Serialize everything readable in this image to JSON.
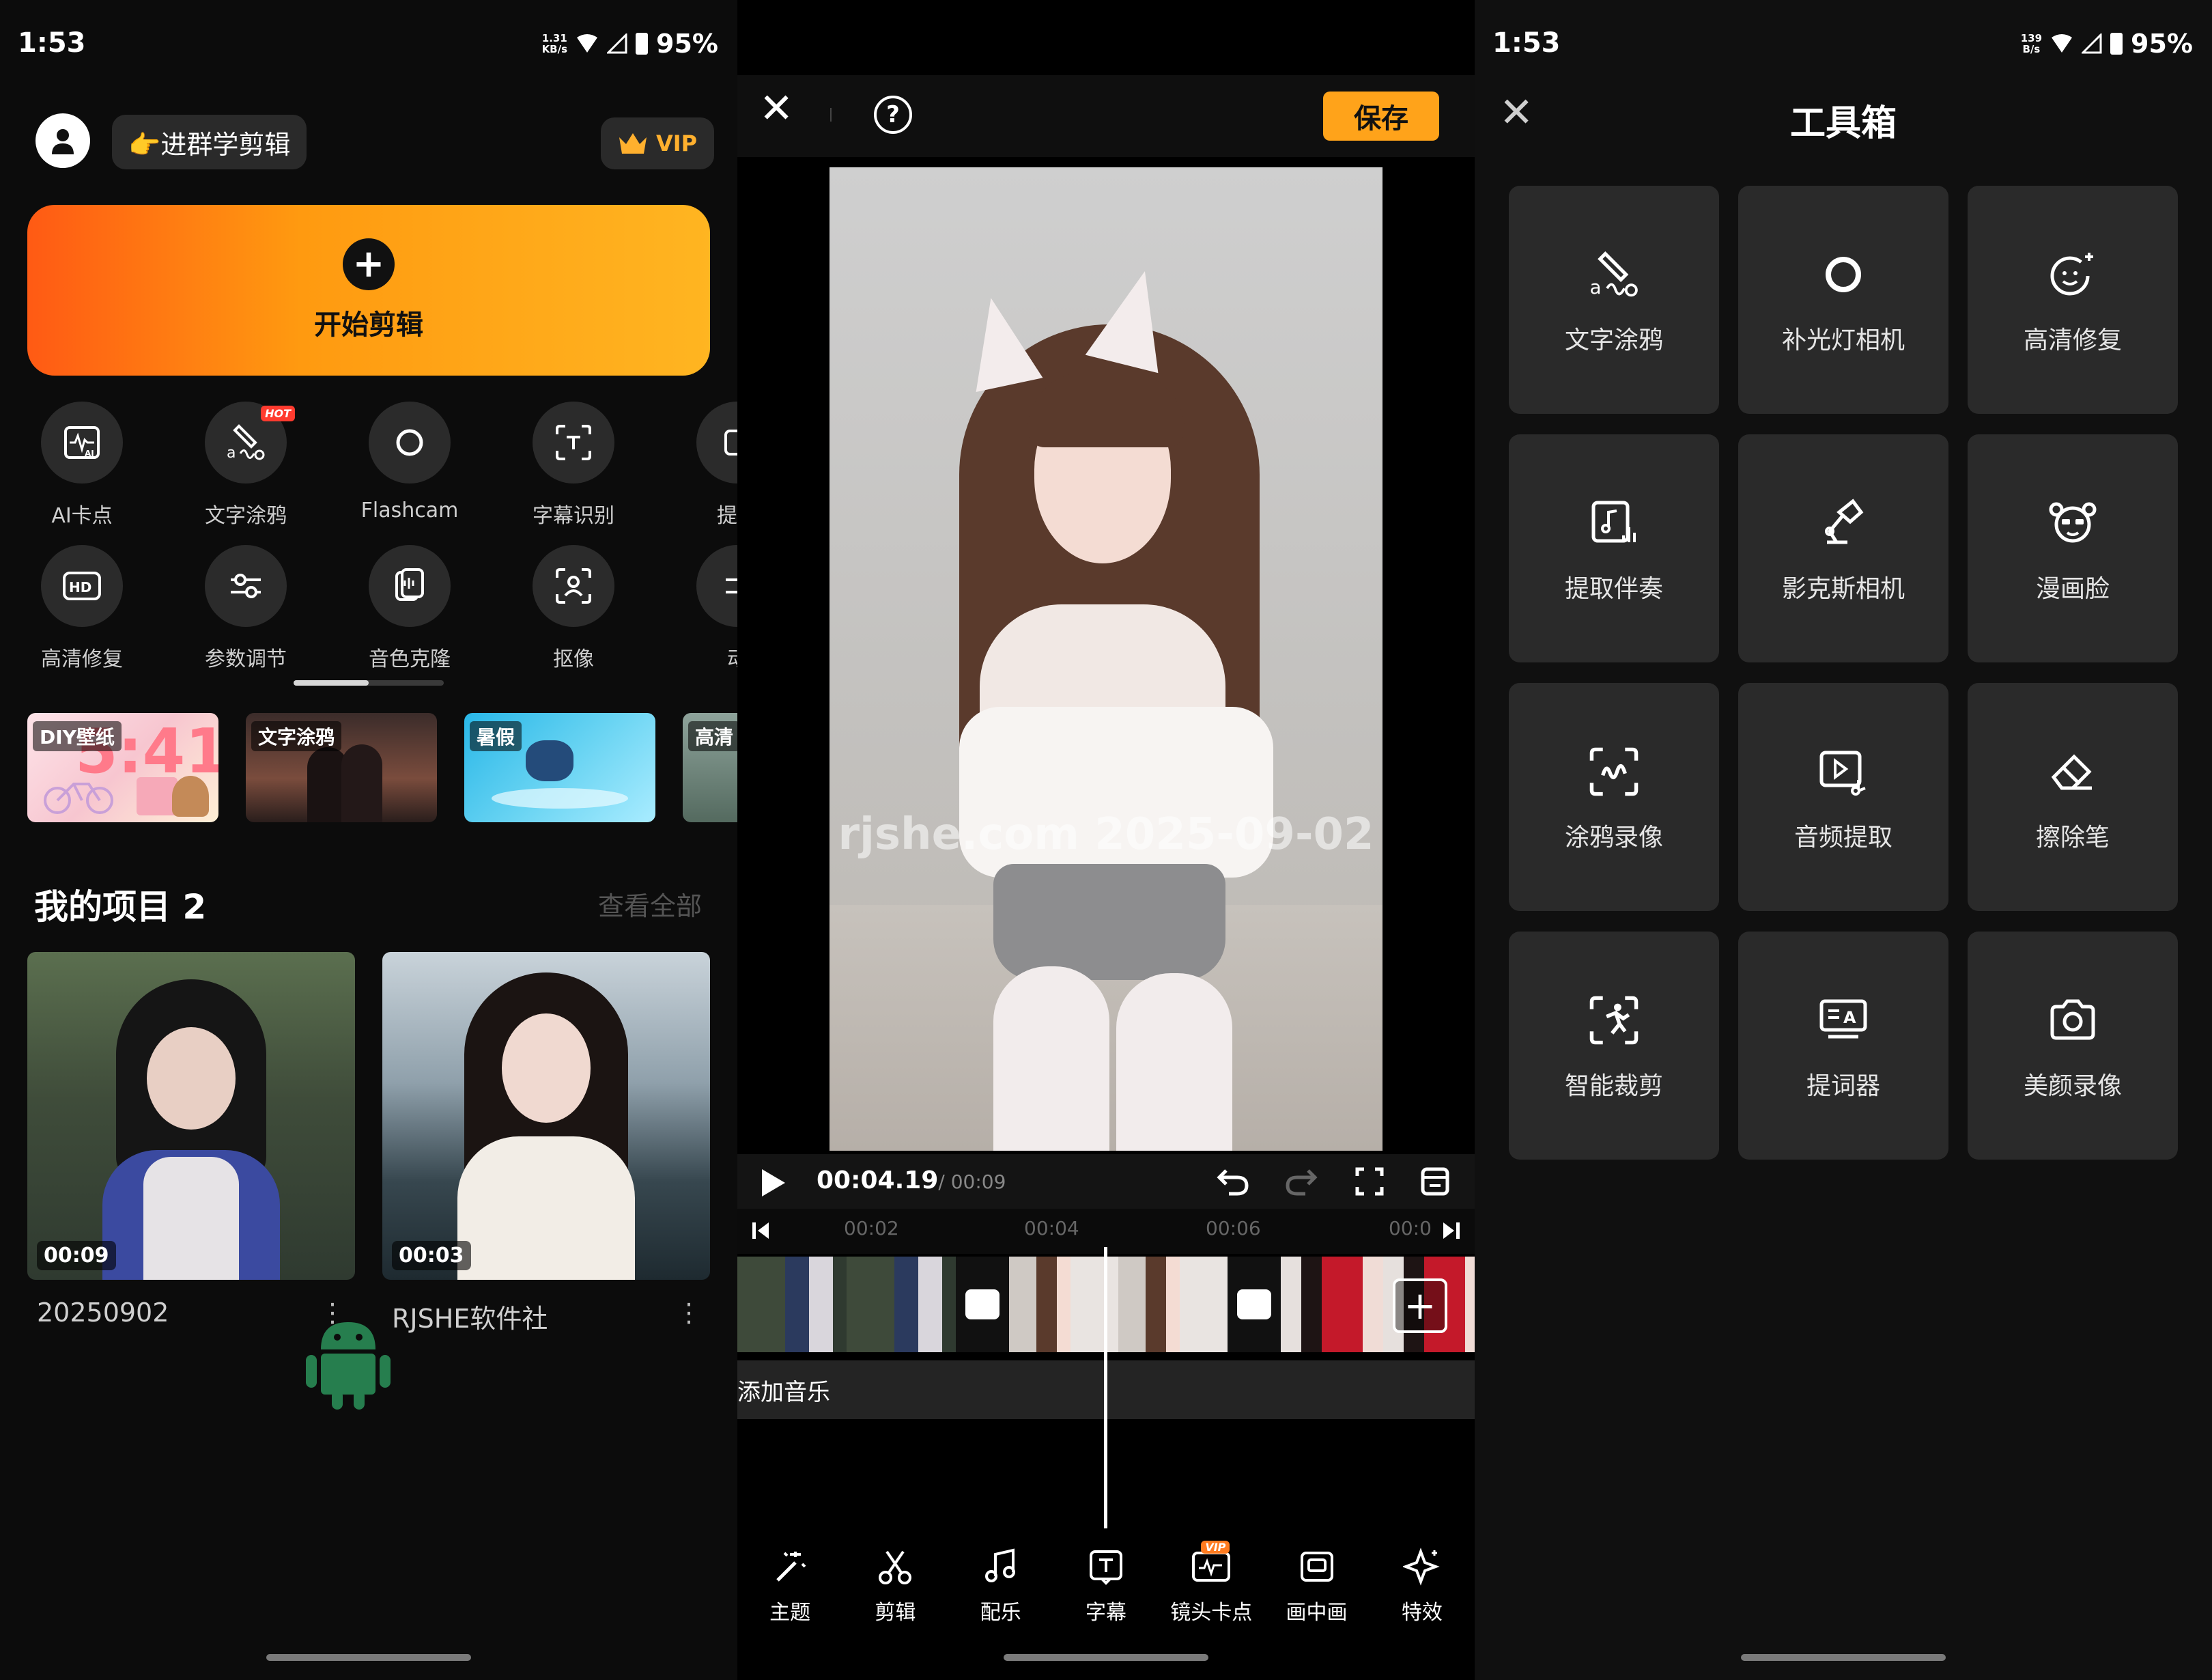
{
  "status_left": {
    "time": "1:53",
    "net_top": "1.31",
    "net_bottom": "KB/s",
    "battery": "95%"
  },
  "status_right": {
    "time": "1:53",
    "net_top": "139",
    "net_bottom": "B/s",
    "battery": "95%"
  },
  "home": {
    "group_label": "👉进群学剪辑",
    "vip_label": "VIP",
    "start_label": "开始剪辑",
    "hot_badge": "HOT",
    "tools_row1": [
      "AI卡点",
      "文字涂鸦",
      "Flashcam",
      "字幕识别",
      "提取"
    ],
    "tools_row2": [
      "高清修复",
      "参数调节",
      "音色克隆",
      "抠像",
      "动"
    ],
    "banners": [
      "DIY壁纸",
      "文字涂鸦",
      "暑假",
      "高清"
    ],
    "banner_1_overlay": "5:41",
    "projects_title": "我的项目 2",
    "view_all": "查看全部",
    "projects": [
      {
        "duration": "00:09",
        "name": "20250902"
      },
      {
        "duration": "00:03",
        "name": "RJSHE软件社"
      }
    ],
    "kebab": "⋮"
  },
  "editor": {
    "save_label": "保存",
    "help_label": "?",
    "watermark": "rjshe.com 2025-09-02",
    "time_current": "00:04.19",
    "time_total": "/ 00:09",
    "ruler": [
      "00:02",
      "00:04",
      "00:06",
      "00:0"
    ],
    "add_music": "添加音乐",
    "tabs": [
      "主题",
      "剪辑",
      "配乐",
      "字幕",
      "镜头卡点",
      "画中画",
      "特效"
    ],
    "vip_badge": "VIP"
  },
  "toolbox": {
    "title": "工具箱",
    "tiles": [
      "文字涂鸦",
      "补光灯相机",
      "高清修复",
      "提取伴奏",
      "影克斯相机",
      "漫画脸",
      "涂鸦录像",
      "音频提取",
      "擦除笔",
      "智能裁剪",
      "提词器",
      "美颜录像"
    ]
  },
  "colors": {
    "accent": "#ffa31a",
    "vip_gold": "#ffb02e",
    "hot": "#ff3b2f",
    "tile_bg": "#2a2a2a"
  }
}
